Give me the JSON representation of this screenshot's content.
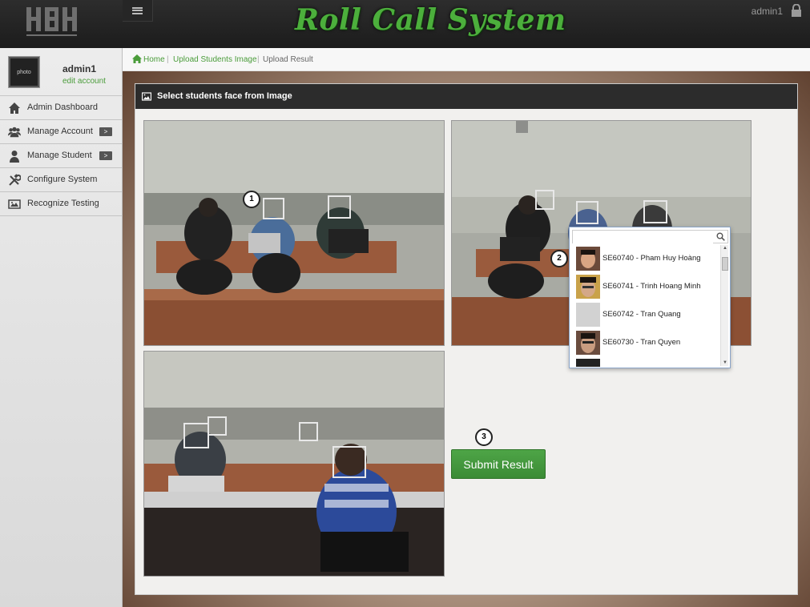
{
  "header": {
    "title": "Roll Call System",
    "user": "admin1",
    "menu_icon": "hamburger-icon",
    "lock_icon": "lock-icon"
  },
  "profile": {
    "photo_label": "photo",
    "name": "admin1",
    "edit_link": "edit account"
  },
  "sidebar": {
    "items": [
      {
        "label": "Admin Dashboard",
        "icon": "home-icon",
        "has_caret": false
      },
      {
        "label": "Manage Account",
        "icon": "users-icon",
        "has_caret": true
      },
      {
        "label": "Manage Student",
        "icon": "user-icon",
        "has_caret": true
      },
      {
        "label": "Configure System",
        "icon": "tools-icon",
        "has_caret": false
      },
      {
        "label": "Recognize Testing",
        "icon": "image-icon",
        "has_caret": false
      }
    ],
    "caret": ">"
  },
  "breadcrumb": {
    "home": "Home",
    "upload": "Upload Students Image",
    "current": "Upload Result",
    "sep": "|"
  },
  "panel": {
    "title": "Select students face from Image"
  },
  "steps": {
    "one": "1",
    "two": "2",
    "three": "3"
  },
  "submit_label": "Submit Result",
  "dropdown": {
    "placeholder": "",
    "items": [
      {
        "label": "SE60740 - Pham Huy Hoàng",
        "thumb": "face"
      },
      {
        "label": "SE60741 - Trinh Hoang Minh",
        "thumb": "face"
      },
      {
        "label": "SE60742 - Tran Quang",
        "thumb": "placeholder"
      },
      {
        "label": "SE60730 - Tran Quyen",
        "thumb": "face"
      }
    ]
  },
  "colors": {
    "accent": "#4a9c3a",
    "title_green": "#4caf3c",
    "topbar": "#1c1c1c",
    "submit": "#459a3f"
  }
}
